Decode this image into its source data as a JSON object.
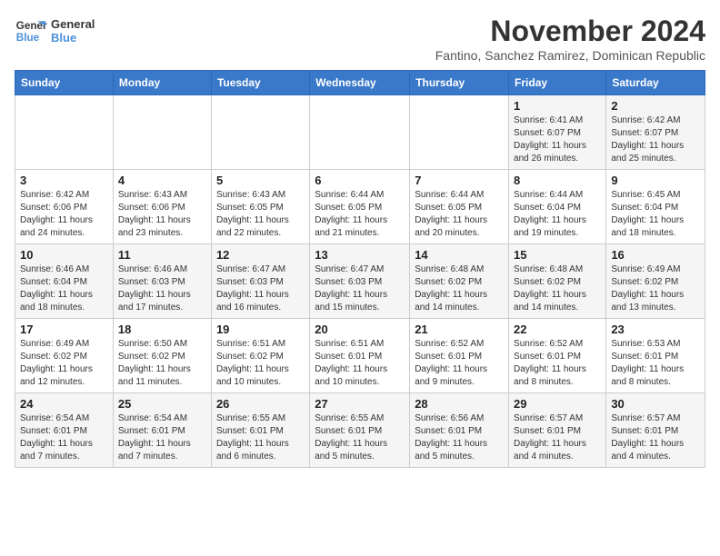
{
  "logo": {
    "line1": "General",
    "line2": "Blue"
  },
  "title": "November 2024",
  "subtitle": "Fantino, Sanchez Ramirez, Dominican Republic",
  "weekdays": [
    "Sunday",
    "Monday",
    "Tuesday",
    "Wednesday",
    "Thursday",
    "Friday",
    "Saturday"
  ],
  "weeks": [
    [
      {
        "day": "",
        "info": ""
      },
      {
        "day": "",
        "info": ""
      },
      {
        "day": "",
        "info": ""
      },
      {
        "day": "",
        "info": ""
      },
      {
        "day": "",
        "info": ""
      },
      {
        "day": "1",
        "info": "Sunrise: 6:41 AM\nSunset: 6:07 PM\nDaylight: 11 hours and 26 minutes."
      },
      {
        "day": "2",
        "info": "Sunrise: 6:42 AM\nSunset: 6:07 PM\nDaylight: 11 hours and 25 minutes."
      }
    ],
    [
      {
        "day": "3",
        "info": "Sunrise: 6:42 AM\nSunset: 6:06 PM\nDaylight: 11 hours and 24 minutes."
      },
      {
        "day": "4",
        "info": "Sunrise: 6:43 AM\nSunset: 6:06 PM\nDaylight: 11 hours and 23 minutes."
      },
      {
        "day": "5",
        "info": "Sunrise: 6:43 AM\nSunset: 6:05 PM\nDaylight: 11 hours and 22 minutes."
      },
      {
        "day": "6",
        "info": "Sunrise: 6:44 AM\nSunset: 6:05 PM\nDaylight: 11 hours and 21 minutes."
      },
      {
        "day": "7",
        "info": "Sunrise: 6:44 AM\nSunset: 6:05 PM\nDaylight: 11 hours and 20 minutes."
      },
      {
        "day": "8",
        "info": "Sunrise: 6:44 AM\nSunset: 6:04 PM\nDaylight: 11 hours and 19 minutes."
      },
      {
        "day": "9",
        "info": "Sunrise: 6:45 AM\nSunset: 6:04 PM\nDaylight: 11 hours and 18 minutes."
      }
    ],
    [
      {
        "day": "10",
        "info": "Sunrise: 6:46 AM\nSunset: 6:04 PM\nDaylight: 11 hours and 18 minutes."
      },
      {
        "day": "11",
        "info": "Sunrise: 6:46 AM\nSunset: 6:03 PM\nDaylight: 11 hours and 17 minutes."
      },
      {
        "day": "12",
        "info": "Sunrise: 6:47 AM\nSunset: 6:03 PM\nDaylight: 11 hours and 16 minutes."
      },
      {
        "day": "13",
        "info": "Sunrise: 6:47 AM\nSunset: 6:03 PM\nDaylight: 11 hours and 15 minutes."
      },
      {
        "day": "14",
        "info": "Sunrise: 6:48 AM\nSunset: 6:02 PM\nDaylight: 11 hours and 14 minutes."
      },
      {
        "day": "15",
        "info": "Sunrise: 6:48 AM\nSunset: 6:02 PM\nDaylight: 11 hours and 14 minutes."
      },
      {
        "day": "16",
        "info": "Sunrise: 6:49 AM\nSunset: 6:02 PM\nDaylight: 11 hours and 13 minutes."
      }
    ],
    [
      {
        "day": "17",
        "info": "Sunrise: 6:49 AM\nSunset: 6:02 PM\nDaylight: 11 hours and 12 minutes."
      },
      {
        "day": "18",
        "info": "Sunrise: 6:50 AM\nSunset: 6:02 PM\nDaylight: 11 hours and 11 minutes."
      },
      {
        "day": "19",
        "info": "Sunrise: 6:51 AM\nSunset: 6:02 PM\nDaylight: 11 hours and 10 minutes."
      },
      {
        "day": "20",
        "info": "Sunrise: 6:51 AM\nSunset: 6:01 PM\nDaylight: 11 hours and 10 minutes."
      },
      {
        "day": "21",
        "info": "Sunrise: 6:52 AM\nSunset: 6:01 PM\nDaylight: 11 hours and 9 minutes."
      },
      {
        "day": "22",
        "info": "Sunrise: 6:52 AM\nSunset: 6:01 PM\nDaylight: 11 hours and 8 minutes."
      },
      {
        "day": "23",
        "info": "Sunrise: 6:53 AM\nSunset: 6:01 PM\nDaylight: 11 hours and 8 minutes."
      }
    ],
    [
      {
        "day": "24",
        "info": "Sunrise: 6:54 AM\nSunset: 6:01 PM\nDaylight: 11 hours and 7 minutes."
      },
      {
        "day": "25",
        "info": "Sunrise: 6:54 AM\nSunset: 6:01 PM\nDaylight: 11 hours and 7 minutes."
      },
      {
        "day": "26",
        "info": "Sunrise: 6:55 AM\nSunset: 6:01 PM\nDaylight: 11 hours and 6 minutes."
      },
      {
        "day": "27",
        "info": "Sunrise: 6:55 AM\nSunset: 6:01 PM\nDaylight: 11 hours and 5 minutes."
      },
      {
        "day": "28",
        "info": "Sunrise: 6:56 AM\nSunset: 6:01 PM\nDaylight: 11 hours and 5 minutes."
      },
      {
        "day": "29",
        "info": "Sunrise: 6:57 AM\nSunset: 6:01 PM\nDaylight: 11 hours and 4 minutes."
      },
      {
        "day": "30",
        "info": "Sunrise: 6:57 AM\nSunset: 6:01 PM\nDaylight: 11 hours and 4 minutes."
      }
    ]
  ]
}
